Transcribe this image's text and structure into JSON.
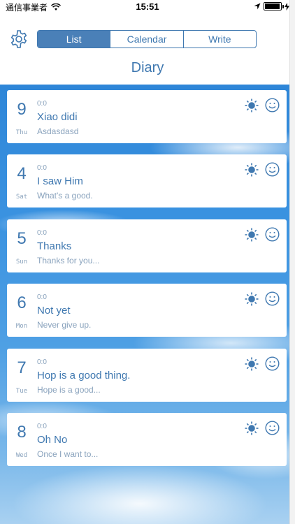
{
  "status_bar": {
    "carrier": "通信事業者",
    "time": "15:51",
    "battery_level": 0.95
  },
  "header": {
    "settings_icon": "gear-icon",
    "tabs": [
      {
        "label": "List",
        "active": true
      },
      {
        "label": "Calendar",
        "active": false
      },
      {
        "label": "Write",
        "active": false
      }
    ],
    "title": "Diary"
  },
  "colors": {
    "accent": "#3f78b0",
    "muted_text": "#8aa3bd",
    "card_bg": "#ffffff",
    "sky_top": "#2e86d8",
    "sky_bottom": "#a9d1f1"
  },
  "entries": [
    {
      "day": "9",
      "weekday": "Thu",
      "time": "0:0",
      "title": "Xiao didi",
      "excerpt": "Asdasdasd",
      "weather": "sun-icon",
      "mood": "smiley-icon"
    },
    {
      "day": "4",
      "weekday": "Sat",
      "time": "0:0",
      "title": "I saw Him",
      "excerpt": "What's a good.",
      "weather": "sun-icon",
      "mood": "smiley-icon"
    },
    {
      "day": "5",
      "weekday": "Sun",
      "time": "0:0",
      "title": "Thanks",
      "excerpt": "Thanks for you...",
      "weather": "sun-icon",
      "mood": "smiley-icon"
    },
    {
      "day": "6",
      "weekday": "Mon",
      "time": "0:0",
      "title": "Not yet",
      "excerpt": "Never give up.",
      "weather": "sun-icon",
      "mood": "smiley-icon"
    },
    {
      "day": "7",
      "weekday": "Tue",
      "time": "0:0",
      "title": "Hop is a good thing.",
      "excerpt": "Hope is a good...",
      "weather": "sun-icon",
      "mood": "smiley-icon"
    },
    {
      "day": "8",
      "weekday": "Wed",
      "time": "0:0",
      "title": "Oh No",
      "excerpt": "Once I want to...",
      "weather": "sun-icon",
      "mood": "smiley-icon"
    }
  ]
}
